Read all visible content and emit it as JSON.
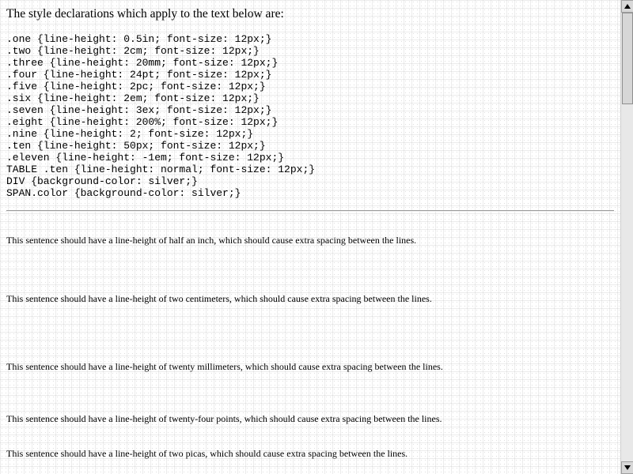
{
  "page": {
    "heading": "The style declarations which apply to the text below are:",
    "code_lines": [
      ".one {line-height: 0.5in; font-size: 12px;}",
      ".two {line-height: 2cm; font-size: 12px;}",
      ".three {line-height: 20mm; font-size: 12px;}",
      ".four {line-height: 24pt; font-size: 12px;}",
      ".five {line-height: 2pc; font-size: 12px;}",
      ".six {line-height: 2em; font-size: 12px;}",
      ".seven {line-height: 3ex; font-size: 12px;}",
      ".eight {line-height: 200%; font-size: 12px;}",
      ".nine {line-height: 2; font-size: 12px;}",
      ".ten {line-height: 50px; font-size: 12px;}",
      ".eleven {line-height: -1em; font-size: 12px;}",
      "TABLE .ten {line-height: normal; font-size: 12px;}",
      "DIV {background-color: silver;}",
      "SPAN.color {background-color: silver;}"
    ],
    "sentences": [
      "This sentence should have a line-height of half an inch, which should cause extra spacing between the lines.",
      "This sentence should have a line-height of two centimeters, which should cause extra spacing between the lines.",
      "This sentence should have a line-height of twenty millimeters, which should cause extra spacing between the lines.",
      "This sentence should have a line-height of twenty-four points, which should cause extra spacing between the lines.",
      "This sentence should have a line-height of two picas, which should cause extra spacing between the lines."
    ]
  },
  "scrollbar": {
    "up_icon": "arrow-up-icon",
    "down_icon": "arrow-down-icon"
  }
}
